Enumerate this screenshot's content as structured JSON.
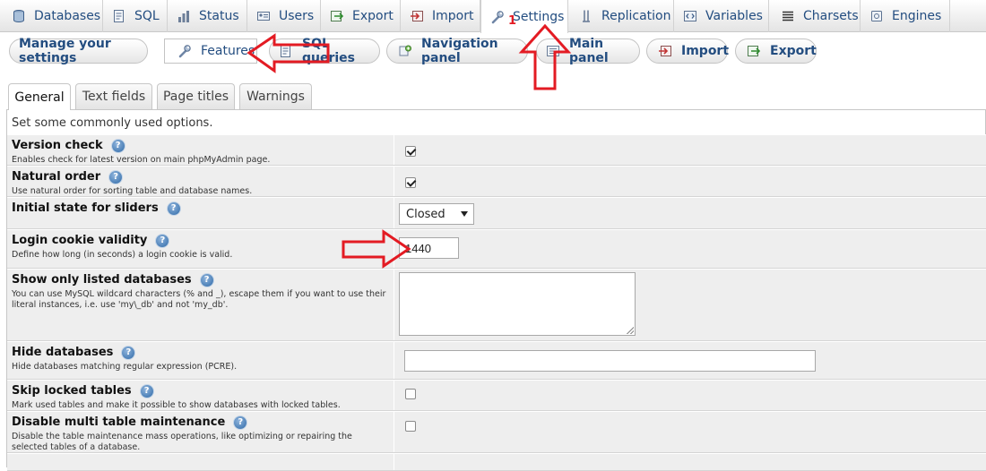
{
  "top_tabs": [
    {
      "label": "Databases",
      "icon": "database-icon"
    },
    {
      "label": "SQL",
      "icon": "sql-icon"
    },
    {
      "label": "Status",
      "icon": "status-icon"
    },
    {
      "label": "Users",
      "icon": "users-icon"
    },
    {
      "label": "Export",
      "icon": "export-icon"
    },
    {
      "label": "Import",
      "icon": "import-icon"
    },
    {
      "label": "Settings",
      "icon": "wrench-icon",
      "active": true
    },
    {
      "label": "Replication",
      "icon": "replication-icon"
    },
    {
      "label": "Variables",
      "icon": "variables-icon"
    },
    {
      "label": "Charsets",
      "icon": "charsets-icon"
    },
    {
      "label": "Engines",
      "icon": "engines-icon"
    }
  ],
  "settings_nav": [
    {
      "label": "Manage your settings"
    },
    {
      "label": "Features",
      "icon": "wrench-icon",
      "active": true
    },
    {
      "label": "SQL queries",
      "icon": "sql-icon"
    },
    {
      "label": "Navigation panel",
      "icon": "navigation-icon"
    },
    {
      "label": "Main panel",
      "icon": "main-panel-icon"
    },
    {
      "label": "Import",
      "icon": "import-icon"
    },
    {
      "label": "Export",
      "icon": "export-icon"
    }
  ],
  "inner_tabs": [
    {
      "label": "General",
      "active": true
    },
    {
      "label": "Text fields"
    },
    {
      "label": "Page titles"
    },
    {
      "label": "Warnings"
    }
  ],
  "panel": {
    "intro": "Set some commonly used options.",
    "help_icon": "help-icon",
    "rows": [
      {
        "label": "Version check",
        "desc": "Enables check for latest version on main phpMyAdmin page.",
        "control": "checkbox",
        "checked": true
      },
      {
        "label": "Natural order",
        "desc": "Use natural order for sorting table and database names.",
        "control": "checkbox",
        "checked": true
      },
      {
        "label": "Initial state for sliders",
        "desc": "",
        "control": "select",
        "value": "Closed"
      },
      {
        "label": "Login cookie validity",
        "desc": "Define how long (in seconds) a login cookie is valid.",
        "control": "text",
        "value": "1440"
      },
      {
        "label": "Show only listed databases",
        "desc": "You can use MySQL wildcard characters (% and _), escape them if you want to use their literal instances, i.e. use 'my\\_db' and not 'my_db'.",
        "control": "textarea",
        "value": ""
      },
      {
        "label": "Hide databases",
        "desc": "Hide databases matching regular expression (PCRE).",
        "control": "text",
        "value": ""
      },
      {
        "label": "Skip locked tables",
        "desc": "Mark used tables and make it possible to show databases with locked tables.",
        "control": "checkbox",
        "checked": false
      },
      {
        "label": "Disable multi table maintenance",
        "desc": "Disable the table maintenance mass operations, like optimizing or repairing the selected tables of a database.",
        "control": "checkbox",
        "checked": false
      }
    ]
  },
  "annotation": {
    "marker": "1",
    "arrow_color": "#e31b23"
  }
}
